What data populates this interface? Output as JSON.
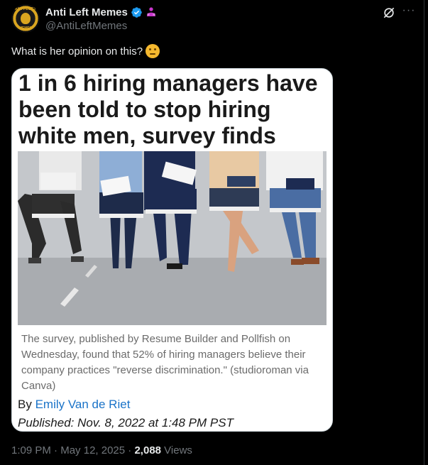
{
  "account": {
    "display_name": "Anti Left Memes",
    "handle": "@AntiLeftMemes",
    "avatar_text_top": "ANTI-LEFT",
    "avatar_text_bottom": "MEMES",
    "verified_color": "#1d9bf0",
    "affiliation_color": "#c936cc",
    "icons": [
      "verified-badge-icon",
      "affiliation-icon"
    ]
  },
  "actions": {
    "grok_icon": "grok-icon",
    "more_label": "···"
  },
  "tweet": {
    "text": "What is her opinion on this?",
    "emoji": "thinking-face-emoji"
  },
  "card": {
    "headline": "1 in 6 hiring managers have been told to stop hiring white men, survey finds",
    "caption": "The survey, published by Resume Builder and Pollfish on Wednesday, found that 52% of hiring managers believe their company practices \"reverse discrimination.\"  (studioroman via Canva)",
    "byline_prefix": "By ",
    "author": "Emily Van de Riet",
    "published": "Published: Nov. 8, 2022 at 1:48 PM PST",
    "author_link_color": "#1a73c8"
  },
  "meta": {
    "time": "1:09 PM",
    "sep1": " · ",
    "date": "May 12, 2025",
    "sep2": " · ",
    "views_count": "2,088",
    "views_label": " Views"
  }
}
